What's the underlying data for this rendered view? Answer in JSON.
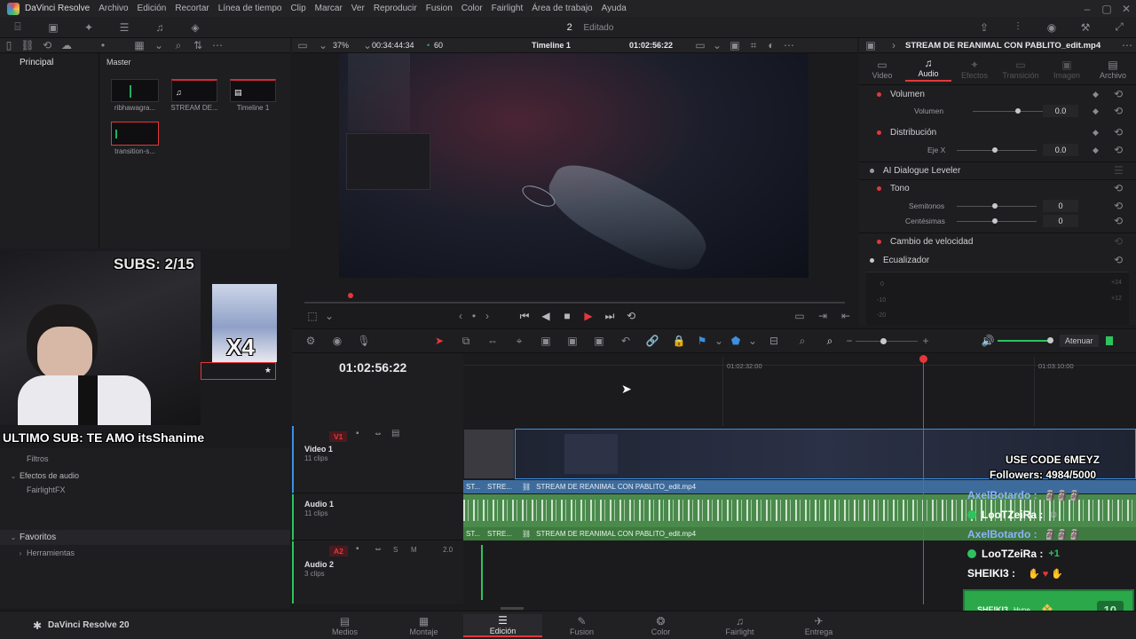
{
  "app": {
    "name": "DaVinci Resolve",
    "product_footer": "DaVinci Resolve 20",
    "accent": "#e4373a",
    "menu": [
      "Archivo",
      "Edición",
      "Recortar",
      "Línea de tiempo",
      "Clip",
      "Marcar",
      "Ver",
      "Reproducir",
      "Fusion",
      "Color",
      "Fairlight",
      "Área de trabajo",
      "Ayuda"
    ],
    "project_number": "2",
    "project_status": "Editado"
  },
  "viewer_bar": {
    "zoom": "37%",
    "source_timecode": "00:34:44:34",
    "fps": "60",
    "timeline_name": "Timeline 1",
    "record_timecode": "01:02:56:22"
  },
  "media_pool": {
    "tab_main": "Principal",
    "tab_master": "Master",
    "clips": [
      {
        "name": "ribhawagra...",
        "color": "#21b15a"
      },
      {
        "name": "STREAM DE...",
        "color": "#d12a3a"
      },
      {
        "name": "Timeline 1",
        "color": "#d12a3a"
      },
      {
        "name": "transition-s...",
        "color": "#21b15a"
      }
    ]
  },
  "effects_panel": {
    "items": [
      "Efectos",
      "Filtros",
      "Efectos de audio",
      "FairlightFX"
    ],
    "favorites": "Favoritos",
    "favorites_child": "Herramientas"
  },
  "inspector": {
    "clip_title": "STREAM DE REANIMAL CON PABLITO_edit.mp4",
    "tabs": [
      "Video",
      "Audio",
      "Efectos",
      "Transición",
      "Imagen",
      "Archivo"
    ],
    "active_tab": "Audio",
    "sections": {
      "volumen": "Volumen",
      "volumen_param": "Volumen",
      "volumen_val": "0.0",
      "distribucion": "Distribución",
      "eje_x": "Eje X",
      "eje_x_val": "0.0",
      "ai_dialogue": "AI Dialogue Leveler",
      "tono": "Tono",
      "semitonos": "Semitonos",
      "semitonos_val": "0",
      "centesimas": "Centésimas",
      "centesimas_val": "0",
      "cambio_velocidad": "Cambio de velocidad",
      "ecualizador": "Ecualizador"
    },
    "eq_scale": [
      "+24",
      "0",
      "-10",
      "-20",
      "+12"
    ]
  },
  "timeline": {
    "timecode": "01:02:56:22",
    "ruler_marks": [
      "01:02:32:00",
      "01:03:10:00"
    ],
    "attenuate_label": "Atenuar",
    "tracks": [
      {
        "id": "V1",
        "name": "Video 1",
        "count": "11 clips"
      },
      {
        "id": "A1",
        "name": "Audio 1",
        "count": "11 clips"
      },
      {
        "id": "A2",
        "name": "Audio 2",
        "count": "3 clips",
        "level": "2.0"
      }
    ],
    "clip_name": "STREAM DE REANIMAL CON PABLITO_edit.mp4",
    "short_clip_a": "ST...",
    "short_clip_b": "STRE..."
  },
  "pages": [
    "Medios",
    "Montaje",
    "Edición",
    "Fusion",
    "Color",
    "Fairlight",
    "Entrega"
  ],
  "active_page": "Edición",
  "stream_overlay": {
    "subs": "SUBS: 2/15",
    "multiplier": "X4",
    "last_sub": "ULTIMO SUB: TE AMO itsShanime",
    "use_code": "USE CODE 6MEYZ",
    "followers": "Followers: 4984/5000",
    "chat": [
      {
        "user": "AxelBotardo :",
        "color": "#8fb2ff"
      },
      {
        "user": "LooTZeiRa :",
        "color": "#ffffff"
      },
      {
        "user": "AxelBotardo :",
        "color": "#8fb2ff"
      },
      {
        "user": "LooTZeiRa :",
        "color": "#ffffff"
      },
      {
        "user": "SHEIKI3 :",
        "color": "#ffffff"
      }
    ],
    "hype_user": "SHEIKI3",
    "hype_label": "Hype",
    "hype_count": "10"
  }
}
